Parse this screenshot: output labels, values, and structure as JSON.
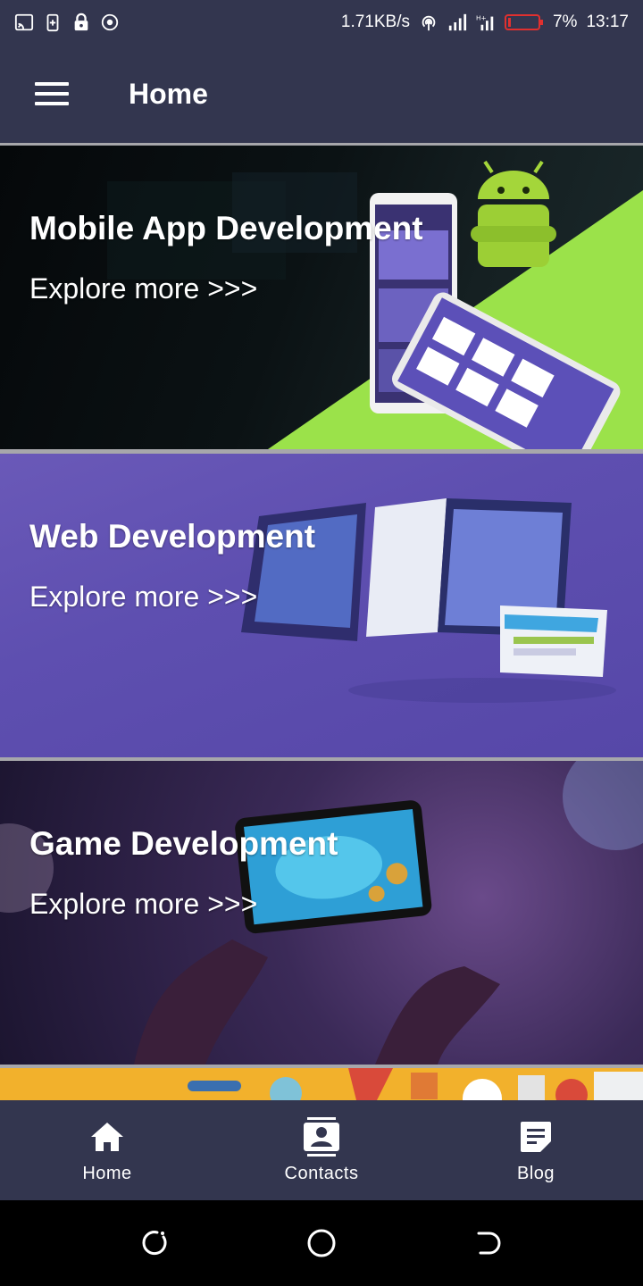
{
  "status_bar": {
    "speed": "1.71KB/s",
    "battery": "7%",
    "time": "13:17",
    "battery_color": "#e0302f"
  },
  "app_bar": {
    "title": "Home",
    "background": "#33364f"
  },
  "cards": [
    {
      "title": "Mobile App Development",
      "cta": "Explore more >>>"
    },
    {
      "title": "Web Development",
      "cta": "Explore more >>>"
    },
    {
      "title": "Game Development",
      "cta": "Explore more >>>"
    }
  ],
  "bottom_nav": {
    "items": [
      {
        "label": "Home",
        "icon": "home-icon"
      },
      {
        "label": "Contacts",
        "icon": "contacts-icon"
      },
      {
        "label": "Blog",
        "icon": "blog-icon"
      }
    ]
  },
  "system_nav": {
    "buttons": [
      "recents-icon",
      "home-circle-icon",
      "back-icon"
    ]
  },
  "colors": {
    "accent_green": "#9be24a",
    "web_purple": "#5e4fb0",
    "banner_orange": "#f2b12c"
  }
}
